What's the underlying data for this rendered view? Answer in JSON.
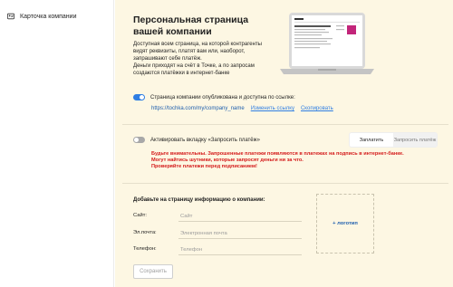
{
  "sidebar": {
    "items": [
      {
        "label": "Карточка компании",
        "icon": "id-card-icon"
      }
    ]
  },
  "hero": {
    "title": "Персональная страница вашей компании",
    "text_lines": [
      "Доступная всем страница, на которой контрагенты",
      "видят реквизиты, платят вам или, наоборот,",
      "запрашивают себе платёж.",
      "Деньги приходят на счёт в Точке, а по запросам",
      "создаются платёжки в интернет-банке"
    ],
    "laptop_image": "laptop-preview-icon"
  },
  "publish": {
    "toggle_on": true,
    "label": "Страница компании опубликована и доступна по ссылке:",
    "url": "https://tochka.com/my/company_name",
    "change_link": "Изменить ссылку",
    "copy_link": "Скопировать"
  },
  "request_tab": {
    "toggle_on": false,
    "label": "Активировать вкладку «Запросить платёж»",
    "tabs": [
      "Заплатить",
      "Запросить платёж"
    ],
    "active_tab": "Заплатить",
    "warning_lines": [
      "Будьте внимательны. Запрошенные платежи появляются в платежах на подпись в интернет-банке.",
      "Могут найтись шутники, которые запросят деньги ни за что.",
      "Проверяйте платежи перед подписанием!"
    ]
  },
  "contact_form": {
    "title": "Добавьте на страницу информацию о компании:",
    "fields": [
      {
        "label": "Сайт:",
        "placeholder": "Сайт",
        "value": ""
      },
      {
        "label": "Эл.почта:",
        "placeholder": "Электронная почта",
        "value": ""
      },
      {
        "label": "Телефон:",
        "placeholder": "Телефон",
        "value": ""
      }
    ],
    "logo_label": "+ логотип",
    "save_label": "Сохранить"
  },
  "colors": {
    "accent": "#2f7ee3",
    "main_background": "#fdf7e3",
    "warning": "#d41a1a"
  }
}
